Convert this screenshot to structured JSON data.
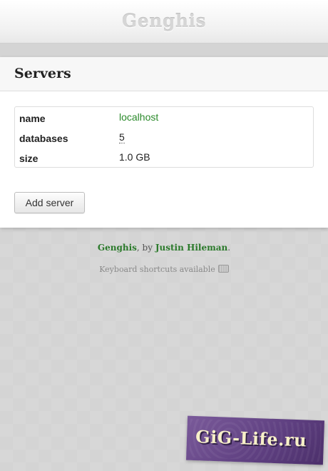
{
  "header": {
    "title": "Genghis"
  },
  "panel": {
    "title": "Servers",
    "properties": [
      {
        "key": "name",
        "value": "localhost"
      },
      {
        "key": "databases",
        "value": "5"
      },
      {
        "key": "size",
        "value": "1.0 GB"
      }
    ],
    "add_button_label": "Add server"
  },
  "footer": {
    "app_link": "Genghis",
    "by_text": ", by ",
    "author_link": "Justin Hileman",
    "period": ".",
    "shortcuts_text": "Keyboard shortcuts available",
    "shortcuts_icon": "keyboard-icon"
  },
  "watermark": {
    "text": "GiG-Life.ru"
  },
  "colors": {
    "link_green": "#2b8a2b",
    "watermark_purple": "#5e3f80"
  }
}
